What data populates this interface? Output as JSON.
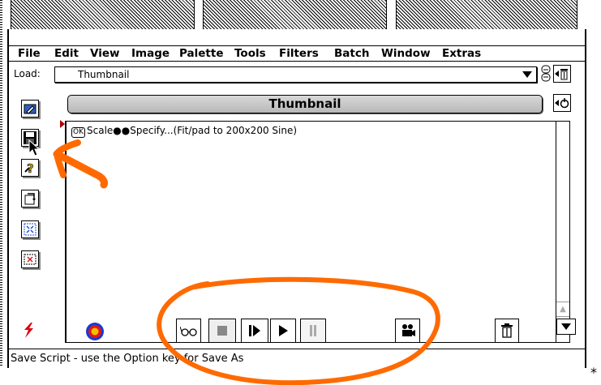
{
  "menu": [
    "File",
    "Edit",
    "View",
    "Image",
    "Palette",
    "Tools",
    "Filters",
    "Batch",
    "Window",
    "Extras"
  ],
  "load": {
    "label": "Load:",
    "value": "Thumbnail"
  },
  "panel": {
    "title": "Thumbnail"
  },
  "script": {
    "ok_badge": "OK",
    "line": "Scale●●Specify...(Fit/pad to 200x200 Sine)"
  },
  "status_text": "Save Script - use the Option key for Save As",
  "corner_mark": "*",
  "annotation_color": "#ff6600",
  "icons": [
    "edit-icon",
    "save-disk-icon",
    "help-icon",
    "rotate-icon",
    "fit-icon",
    "crop-icon",
    "lightning-icon",
    "target-icon",
    "glasses-icon",
    "stop-icon",
    "step-icon",
    "play-icon",
    "pause-icon",
    "record-camera-icon",
    "trash-icon",
    "dropdown-icon"
  ]
}
